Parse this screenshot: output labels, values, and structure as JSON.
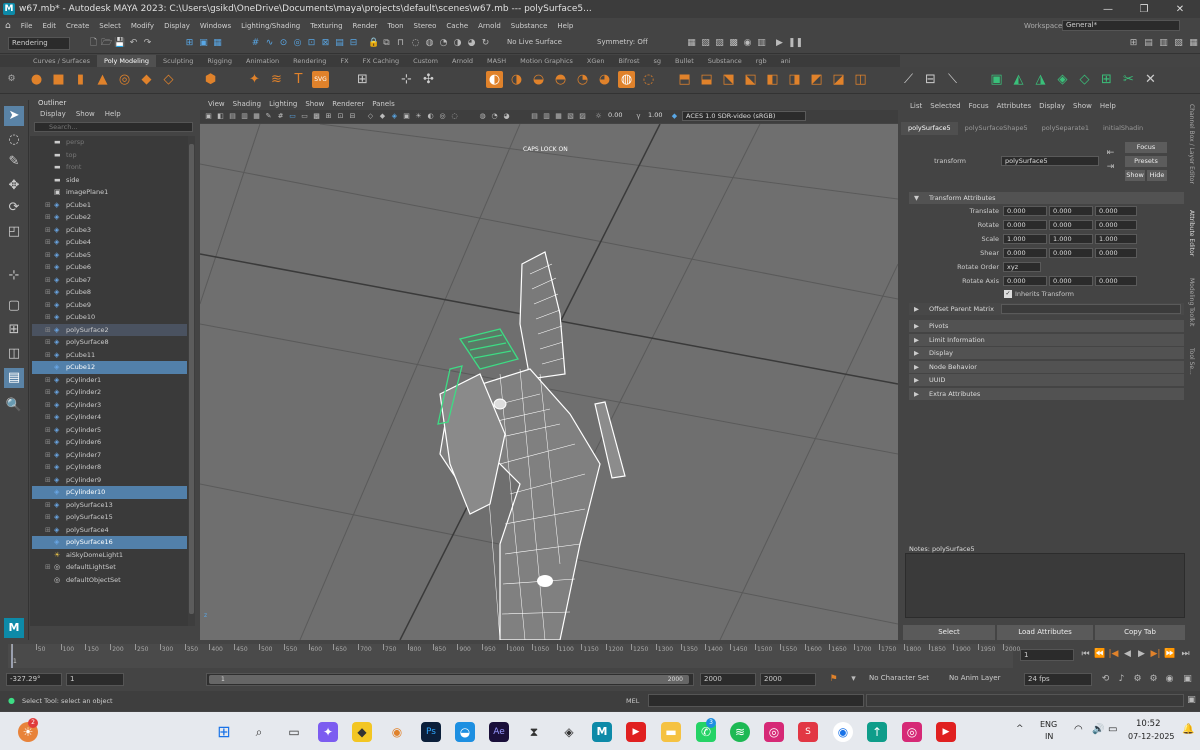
{
  "window": {
    "title": "w67.mb* - Autodesk MAYA 2023: C:\\Users\\gsikd\\OneDrive\\Documents\\maya\\projects\\default\\scenes\\w67.mb   ---   polySurface5...",
    "workspace_label": "Workspace:",
    "workspace_value": "General*"
  },
  "menus": [
    "File",
    "Edit",
    "Create",
    "Select",
    "Modify",
    "Display",
    "Windows",
    "Lighting/Shading",
    "Texturing",
    "Render",
    "Toon",
    "Stereo",
    "Cache",
    "Arnold",
    "Substance",
    "Help"
  ],
  "statusline": {
    "menuset": "Rendering",
    "live_surface": "No Live Surface",
    "symmetry": "Symmetry: Off"
  },
  "shelf_tabs": [
    "Curves / Surfaces",
    "Poly Modeling",
    "Sculpting",
    "Rigging",
    "Animation",
    "Rendering",
    "FX",
    "FX Caching",
    "Custom",
    "Arnold",
    "MASH",
    "Motion Graphics",
    "XGen",
    "Bifrost",
    "sg",
    "Bullet",
    "Substance",
    "rgb",
    "ani"
  ],
  "shelf_active": "Poly Modeling",
  "outliner": {
    "title": "Outliner",
    "menu": [
      "Display",
      "Show",
      "Help"
    ],
    "search_placeholder": "Search...",
    "items": [
      {
        "label": "persp",
        "type": "cam",
        "dim": true
      },
      {
        "label": "top",
        "type": "cam",
        "dim": true
      },
      {
        "label": "front",
        "type": "cam",
        "dim": true
      },
      {
        "label": "side",
        "type": "cam"
      },
      {
        "label": "imagePlane1",
        "type": "img"
      },
      {
        "label": "pCube1",
        "type": "mesh",
        "plus": true
      },
      {
        "label": "pCube2",
        "type": "mesh",
        "plus": true
      },
      {
        "label": "pCube3",
        "type": "mesh",
        "plus": true
      },
      {
        "label": "pCube4",
        "type": "mesh",
        "plus": true
      },
      {
        "label": "pCube5",
        "type": "mesh",
        "plus": true
      },
      {
        "label": "pCube6",
        "type": "mesh",
        "plus": true
      },
      {
        "label": "pCube7",
        "type": "mesh",
        "plus": true
      },
      {
        "label": "pCube8",
        "type": "mesh",
        "plus": true
      },
      {
        "label": "pCube9",
        "type": "mesh",
        "plus": true
      },
      {
        "label": "pCube10",
        "type": "mesh",
        "plus": true
      },
      {
        "label": "polySurface2",
        "type": "mesh",
        "plus": true,
        "state": "hl"
      },
      {
        "label": "polySurface8",
        "type": "mesh",
        "plus": true
      },
      {
        "label": "pCube11",
        "type": "mesh",
        "plus": true
      },
      {
        "label": "pCube12",
        "type": "mesh",
        "state": "sel"
      },
      {
        "label": "pCylinder1",
        "type": "mesh",
        "plus": true
      },
      {
        "label": "pCylinder2",
        "type": "mesh",
        "plus": true
      },
      {
        "label": "pCylinder3",
        "type": "mesh",
        "plus": true
      },
      {
        "label": "pCylinder4",
        "type": "mesh",
        "plus": true
      },
      {
        "label": "pCylinder5",
        "type": "mesh",
        "plus": true
      },
      {
        "label": "pCylinder6",
        "type": "mesh",
        "plus": true
      },
      {
        "label": "pCylinder7",
        "type": "mesh",
        "plus": true
      },
      {
        "label": "pCylinder8",
        "type": "mesh",
        "plus": true
      },
      {
        "label": "pCylinder9",
        "type": "mesh",
        "plus": true
      },
      {
        "label": "pCylinder10",
        "type": "mesh",
        "state": "sel"
      },
      {
        "label": "polySurface13",
        "type": "mesh",
        "plus": true
      },
      {
        "label": "polySurface15",
        "type": "mesh",
        "plus": true
      },
      {
        "label": "polySurface4",
        "type": "mesh",
        "plus": true
      },
      {
        "label": "polySurface16",
        "type": "mesh",
        "state": "sel"
      },
      {
        "label": "aiSkyDomeLight1",
        "type": "light"
      },
      {
        "label": "defaultLightSet",
        "type": "set",
        "plus": true
      },
      {
        "label": "defaultObjectSet",
        "type": "set"
      }
    ]
  },
  "viewport": {
    "menu": [
      "View",
      "Shading",
      "Lighting",
      "Show",
      "Renderer",
      "Panels"
    ],
    "exposure": "0.00",
    "gamma": "1.00",
    "color_space": "ACES 1.0 SDR-video (sRGB)",
    "hud_caps": "CAPS LOCK ON",
    "axis_label": "z"
  },
  "attr": {
    "menu": [
      "List",
      "Selected",
      "Focus",
      "Attributes",
      "Display",
      "Show",
      "Help"
    ],
    "tabs": [
      "polySurface5",
      "polySurfaceShape5",
      "polySeparate1",
      "initialShadin"
    ],
    "transform_label": "transform",
    "transform_value": "polySurface5",
    "buttons": {
      "focus": "Focus",
      "presets": "Presets",
      "show": "Show",
      "hide": "Hide"
    },
    "section_transform": "Transform Attributes",
    "rows": [
      {
        "label": "Translate",
        "v": [
          "0.000",
          "0.000",
          "0.000"
        ]
      },
      {
        "label": "Rotate",
        "v": [
          "0.000",
          "0.000",
          "0.000"
        ]
      },
      {
        "label": "Scale",
        "v": [
          "1.000",
          "1.000",
          "1.000"
        ]
      },
      {
        "label": "Shear",
        "v": [
          "0.000",
          "0.000",
          "0.000"
        ]
      }
    ],
    "rotate_order_label": "Rotate Order",
    "rotate_order": "xyz",
    "rotate_axis_label": "Rotate Axis",
    "rotate_axis": [
      "0.000",
      "0.000",
      "0.000"
    ],
    "inherits": "Inherits Transform",
    "offset": "Offset Parent Matrix",
    "sections": [
      "Pivots",
      "Limit Information",
      "Display",
      "Node Behavior",
      "UUID",
      "Extra Attributes"
    ],
    "notes": "Notes:  polySurface5",
    "bottom": [
      "Select",
      "Load Attributes",
      "Copy Tab"
    ],
    "side_tabs": [
      "Channel Box / Layer Editor",
      "Attribute Editor",
      "Modeling Toolkit",
      "Tool Se..."
    ]
  },
  "timeline": {
    "ticks": [
      "1",
      "50",
      "100",
      "150",
      "200",
      "250",
      "300",
      "350",
      "400",
      "450",
      "500",
      "550",
      "600",
      "650",
      "700",
      "750",
      "800",
      "850",
      "900",
      "950",
      "1000",
      "1050",
      "1100",
      "1150",
      "1200",
      "1250",
      "1300",
      "1350",
      "1400",
      "1450",
      "1500",
      "1550",
      "1600",
      "1650",
      "1700",
      "1750",
      "1800",
      "1850",
      "1900",
      "1950",
      "2000"
    ],
    "current": "1",
    "frame_field": "1"
  },
  "range": {
    "left_value": "-327.29°",
    "start": "1",
    "range_start": "1",
    "range_end": "2000",
    "end1": "2000",
    "end2": "2000",
    "char_set": "No Character Set",
    "anim_layer": "No Anim Layer",
    "fps": "24 fps"
  },
  "cmd": {
    "mel": "MEL",
    "help": "Select Tool: select an object"
  },
  "taskbar": {
    "badge": "2",
    "whatsapp_badge": "3",
    "lang1": "ENG",
    "lang2": "IN",
    "time": "10:52",
    "date": "07-12-2025"
  },
  "colors": {
    "bg": "#444444",
    "selection": "#5280aa",
    "wire_select": "#3ddc84",
    "accent_shelf": "#e0822b"
  }
}
